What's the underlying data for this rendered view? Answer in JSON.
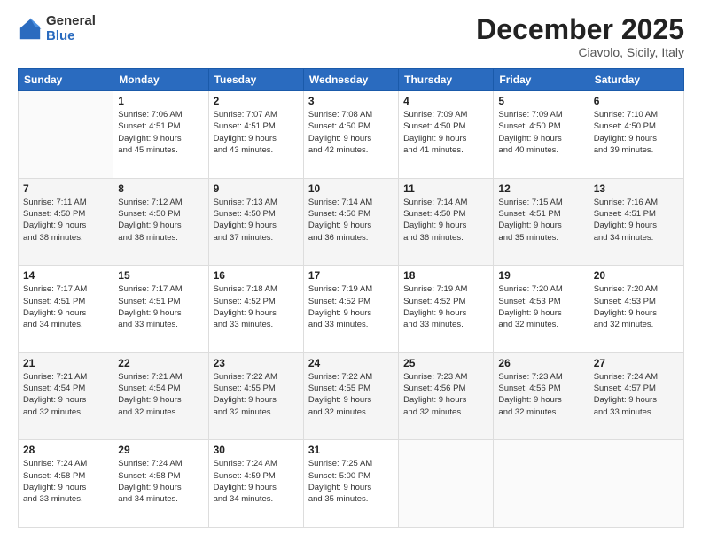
{
  "logo": {
    "general": "General",
    "blue": "Blue"
  },
  "header": {
    "month": "December 2025",
    "location": "Ciavolo, Sicily, Italy"
  },
  "weekdays": [
    "Sunday",
    "Monday",
    "Tuesday",
    "Wednesday",
    "Thursday",
    "Friday",
    "Saturday"
  ],
  "weeks": [
    [
      {
        "day": "",
        "info": ""
      },
      {
        "day": "1",
        "info": "Sunrise: 7:06 AM\nSunset: 4:51 PM\nDaylight: 9 hours\nand 45 minutes."
      },
      {
        "day": "2",
        "info": "Sunrise: 7:07 AM\nSunset: 4:51 PM\nDaylight: 9 hours\nand 43 minutes."
      },
      {
        "day": "3",
        "info": "Sunrise: 7:08 AM\nSunset: 4:50 PM\nDaylight: 9 hours\nand 42 minutes."
      },
      {
        "day": "4",
        "info": "Sunrise: 7:09 AM\nSunset: 4:50 PM\nDaylight: 9 hours\nand 41 minutes."
      },
      {
        "day": "5",
        "info": "Sunrise: 7:09 AM\nSunset: 4:50 PM\nDaylight: 9 hours\nand 40 minutes."
      },
      {
        "day": "6",
        "info": "Sunrise: 7:10 AM\nSunset: 4:50 PM\nDaylight: 9 hours\nand 39 minutes."
      }
    ],
    [
      {
        "day": "7",
        "info": "Sunrise: 7:11 AM\nSunset: 4:50 PM\nDaylight: 9 hours\nand 38 minutes."
      },
      {
        "day": "8",
        "info": "Sunrise: 7:12 AM\nSunset: 4:50 PM\nDaylight: 9 hours\nand 38 minutes."
      },
      {
        "day": "9",
        "info": "Sunrise: 7:13 AM\nSunset: 4:50 PM\nDaylight: 9 hours\nand 37 minutes."
      },
      {
        "day": "10",
        "info": "Sunrise: 7:14 AM\nSunset: 4:50 PM\nDaylight: 9 hours\nand 36 minutes."
      },
      {
        "day": "11",
        "info": "Sunrise: 7:14 AM\nSunset: 4:50 PM\nDaylight: 9 hours\nand 36 minutes."
      },
      {
        "day": "12",
        "info": "Sunrise: 7:15 AM\nSunset: 4:51 PM\nDaylight: 9 hours\nand 35 minutes."
      },
      {
        "day": "13",
        "info": "Sunrise: 7:16 AM\nSunset: 4:51 PM\nDaylight: 9 hours\nand 34 minutes."
      }
    ],
    [
      {
        "day": "14",
        "info": "Sunrise: 7:17 AM\nSunset: 4:51 PM\nDaylight: 9 hours\nand 34 minutes."
      },
      {
        "day": "15",
        "info": "Sunrise: 7:17 AM\nSunset: 4:51 PM\nDaylight: 9 hours\nand 33 minutes."
      },
      {
        "day": "16",
        "info": "Sunrise: 7:18 AM\nSunset: 4:52 PM\nDaylight: 9 hours\nand 33 minutes."
      },
      {
        "day": "17",
        "info": "Sunrise: 7:19 AM\nSunset: 4:52 PM\nDaylight: 9 hours\nand 33 minutes."
      },
      {
        "day": "18",
        "info": "Sunrise: 7:19 AM\nSunset: 4:52 PM\nDaylight: 9 hours\nand 33 minutes."
      },
      {
        "day": "19",
        "info": "Sunrise: 7:20 AM\nSunset: 4:53 PM\nDaylight: 9 hours\nand 32 minutes."
      },
      {
        "day": "20",
        "info": "Sunrise: 7:20 AM\nSunset: 4:53 PM\nDaylight: 9 hours\nand 32 minutes."
      }
    ],
    [
      {
        "day": "21",
        "info": "Sunrise: 7:21 AM\nSunset: 4:54 PM\nDaylight: 9 hours\nand 32 minutes."
      },
      {
        "day": "22",
        "info": "Sunrise: 7:21 AM\nSunset: 4:54 PM\nDaylight: 9 hours\nand 32 minutes."
      },
      {
        "day": "23",
        "info": "Sunrise: 7:22 AM\nSunset: 4:55 PM\nDaylight: 9 hours\nand 32 minutes."
      },
      {
        "day": "24",
        "info": "Sunrise: 7:22 AM\nSunset: 4:55 PM\nDaylight: 9 hours\nand 32 minutes."
      },
      {
        "day": "25",
        "info": "Sunrise: 7:23 AM\nSunset: 4:56 PM\nDaylight: 9 hours\nand 32 minutes."
      },
      {
        "day": "26",
        "info": "Sunrise: 7:23 AM\nSunset: 4:56 PM\nDaylight: 9 hours\nand 32 minutes."
      },
      {
        "day": "27",
        "info": "Sunrise: 7:24 AM\nSunset: 4:57 PM\nDaylight: 9 hours\nand 33 minutes."
      }
    ],
    [
      {
        "day": "28",
        "info": "Sunrise: 7:24 AM\nSunset: 4:58 PM\nDaylight: 9 hours\nand 33 minutes."
      },
      {
        "day": "29",
        "info": "Sunrise: 7:24 AM\nSunset: 4:58 PM\nDaylight: 9 hours\nand 34 minutes."
      },
      {
        "day": "30",
        "info": "Sunrise: 7:24 AM\nSunset: 4:59 PM\nDaylight: 9 hours\nand 34 minutes."
      },
      {
        "day": "31",
        "info": "Sunrise: 7:25 AM\nSunset: 5:00 PM\nDaylight: 9 hours\nand 35 minutes."
      },
      {
        "day": "",
        "info": ""
      },
      {
        "day": "",
        "info": ""
      },
      {
        "day": "",
        "info": ""
      }
    ]
  ]
}
